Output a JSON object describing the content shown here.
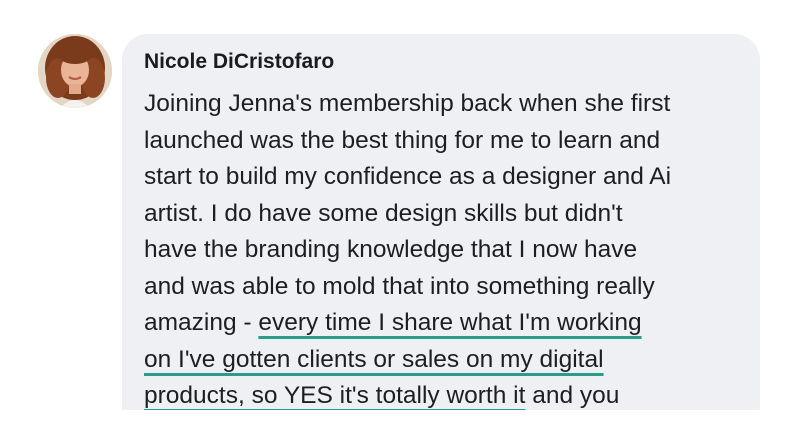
{
  "comment": {
    "author": "Nicole DiCristofaro",
    "avatar_icon": "profile-photo",
    "highlight_color": "#2a9d8a",
    "lines": [
      "Joining Jenna's membership back when she first",
      "launched was the best thing for me to learn and",
      "start to build my confidence as a designer and Ai",
      "artist. I do have some design skills but didn't",
      "have the branding knowledge that I now have",
      "and was able to mold that into something really",
      "amazing - ",
      "every time I share what I'm working",
      "on I've gotten clients or sales on my digital",
      "products, so YES it's totally worth it",
      " and you"
    ]
  }
}
